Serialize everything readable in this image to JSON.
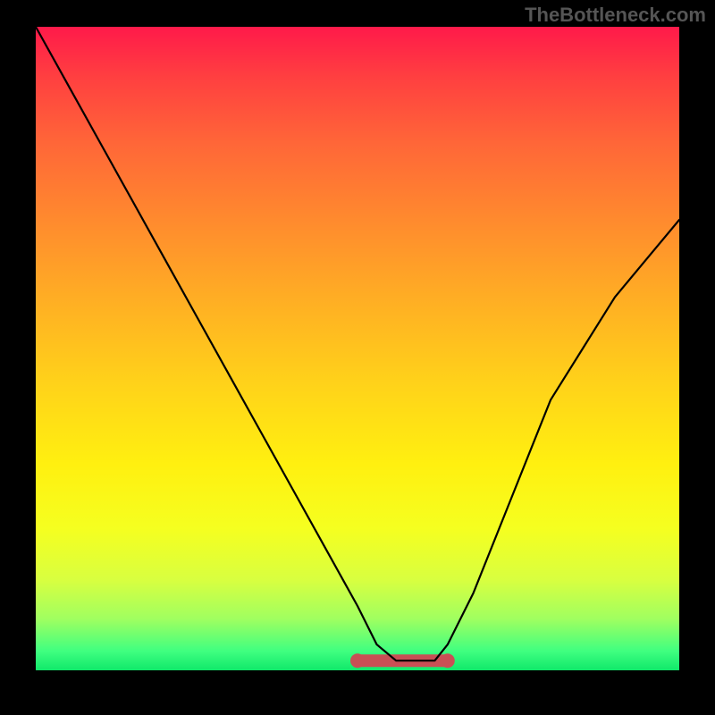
{
  "watermark": "TheBottleneck.com",
  "colors": {
    "background": "#000000",
    "gradient_top": "#ff1a4a",
    "gradient_bottom": "#10e86a",
    "curve": "#000000",
    "valley_accent": "#c94f55"
  },
  "chart_data": {
    "type": "line",
    "title": "",
    "xlabel": "",
    "ylabel": "",
    "xlim": [
      0,
      100
    ],
    "ylim": [
      0,
      100
    ],
    "grid": false,
    "legend": false,
    "background": "vertical gradient red→orange→yellow→green",
    "series": [
      {
        "name": "bottleneck-curve",
        "color": "#000000",
        "x": [
          0,
          5,
          10,
          15,
          20,
          25,
          30,
          35,
          40,
          45,
          50,
          53,
          56,
          60,
          62,
          64,
          68,
          72,
          76,
          80,
          85,
          90,
          95,
          100
        ],
        "values": [
          100,
          91,
          82,
          73,
          64,
          55,
          46,
          37,
          28,
          19,
          10,
          4,
          1.5,
          1.5,
          1.5,
          4,
          12,
          22,
          32,
          42,
          50,
          58,
          64,
          70
        ]
      }
    ],
    "valley_highlight": {
      "color": "#c94f55",
      "x_range": [
        50,
        64
      ],
      "y": 1.5
    }
  }
}
